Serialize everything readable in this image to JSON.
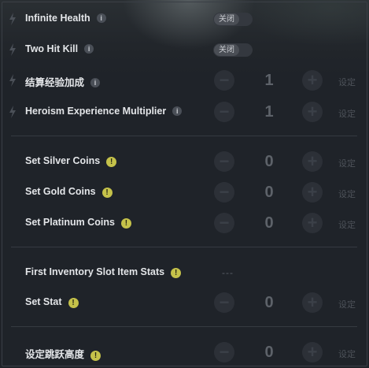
{
  "rows": [
    {
      "label": "Infinite Health",
      "toggle": "关闭"
    },
    {
      "label": "Two Hit Kill",
      "toggle": "关闭"
    },
    {
      "label": "结算经验加成",
      "value": "1",
      "set": "设定"
    },
    {
      "label": "Heroism Experience Multiplier",
      "value": "1",
      "set": "设定"
    },
    {
      "label": "Set Silver Coins",
      "value": "0",
      "set": "设定"
    },
    {
      "label": "Set Gold Coins",
      "value": "0",
      "set": "设定"
    },
    {
      "label": "Set Platinum Coins",
      "value": "0",
      "set": "设定"
    },
    {
      "label": "First Inventory Slot Item Stats",
      "placeholder": "---"
    },
    {
      "label": "Set Stat",
      "value": "0",
      "set": "设定"
    },
    {
      "label": "设定跳跃高度",
      "value": "0",
      "set": "设定"
    }
  ],
  "icons": {
    "info": "i",
    "warning": "!",
    "minus": "−",
    "plus": "+"
  },
  "colors": {
    "background": "#1f2329",
    "warning": "#c5c24a",
    "text": "#e3e5e8"
  }
}
